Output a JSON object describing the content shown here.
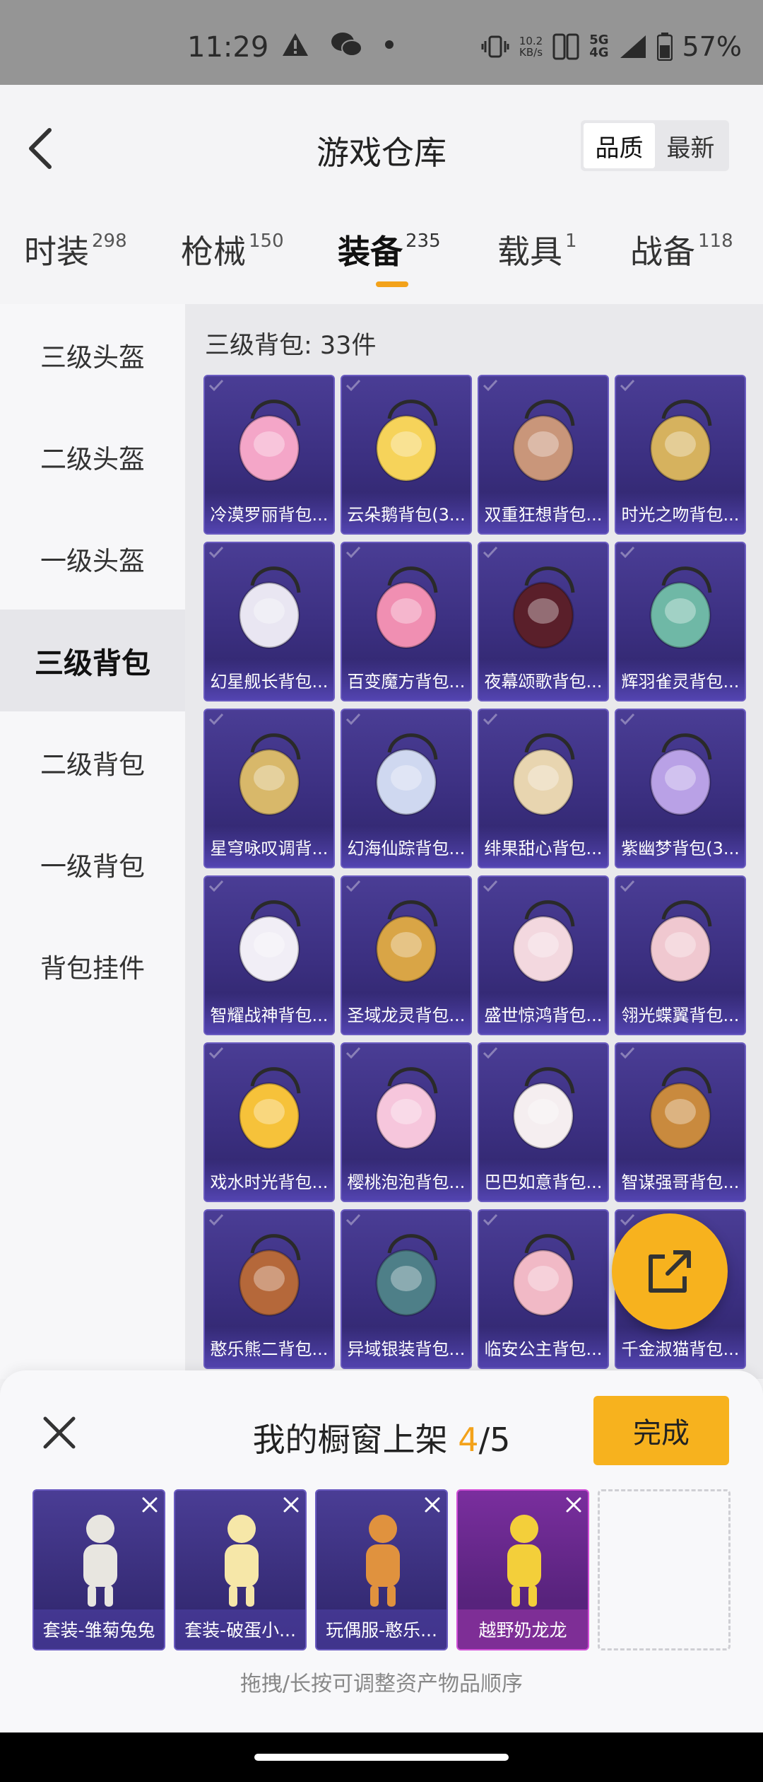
{
  "status_bar": {
    "time": "11:29",
    "net_speed_value": "10.2",
    "net_speed_unit": "KB/s",
    "signal_label_top": "5G",
    "signal_label_bottom": "4G",
    "battery": "57%"
  },
  "header": {
    "title": "游戏仓库",
    "sort_options": [
      "品质",
      "最新"
    ],
    "sort_selected": "品质"
  },
  "tabs": [
    {
      "label": "时装",
      "count": "298"
    },
    {
      "label": "枪械",
      "count": "150"
    },
    {
      "label": "装备",
      "count": "235",
      "active": true
    },
    {
      "label": "载具",
      "count": "1"
    },
    {
      "label": "战备",
      "count": "118"
    }
  ],
  "sidebar": {
    "items": [
      "三级头盔",
      "二级头盔",
      "一级头盔",
      "三级背包",
      "二级背包",
      "一级背包",
      "背包挂件"
    ],
    "active": "三级背包"
  },
  "content": {
    "section_label": "三级背包: 33件",
    "items": [
      {
        "name": "冷漠罗丽背包...",
        "icon": "heart-backpack-icon",
        "color": "#f4a6c8"
      },
      {
        "name": "云朵鹅背包(3...",
        "icon": "duck-backpack-icon",
        "color": "#f6d35a"
      },
      {
        "name": "双重狂想背包...",
        "icon": "fawn-backpack-icon",
        "color": "#c9967a"
      },
      {
        "name": "时光之吻背包...",
        "icon": "clock-backpack-icon",
        "color": "#d6b25e"
      },
      {
        "name": "幻星舰长背包...",
        "icon": "rocket-backpack-icon",
        "color": "#e9e6f2"
      },
      {
        "name": "百变魔方背包...",
        "icon": "cube-backpack-icon",
        "color": "#f08fb2"
      },
      {
        "name": "夜幕颂歌背包...",
        "icon": "dark-rose-backpack-icon",
        "color": "#5a1f2a"
      },
      {
        "name": "辉羽雀灵背包...",
        "icon": "bird-backpack-icon",
        "color": "#6fb8a6"
      },
      {
        "name": "星穹咏叹调背...",
        "icon": "harp-backpack-icon",
        "color": "#d8b86a"
      },
      {
        "name": "幻海仙踪背包...",
        "icon": "crystal-backpack-icon",
        "color": "#cfd8f0"
      },
      {
        "name": "绯果甜心背包...",
        "icon": "clown-backpack-icon",
        "color": "#e8d5b0"
      },
      {
        "name": "紫幽梦背包(3...",
        "icon": "lotus-backpack-icon",
        "color": "#b9a1e6"
      },
      {
        "name": "智耀战神背包...",
        "icon": "armor-backpack-icon",
        "color": "#f1eef6"
      },
      {
        "name": "圣域龙灵背包...",
        "icon": "dragon-backpack-icon",
        "color": "#d9a546"
      },
      {
        "name": "盛世惊鸿背包...",
        "icon": "feather-backpack-icon",
        "color": "#f3d8df"
      },
      {
        "name": "翎光蝶翼背包...",
        "icon": "butterfly-heart-backpack-icon",
        "color": "#f0c8d0"
      },
      {
        "name": "戏水时光背包...",
        "icon": "chick-backpack-icon",
        "color": "#f6c23a"
      },
      {
        "name": "樱桃泡泡背包...",
        "icon": "bow-backpack-icon",
        "color": "#f6c6dc"
      },
      {
        "name": "巴巴如意背包...",
        "icon": "cat-backpack-icon",
        "color": "#f5eef0"
      },
      {
        "name": "智谋强哥背包...",
        "icon": "monkey-backpack-icon",
        "color": "#c98a3e"
      },
      {
        "name": "憨乐熊二背包...",
        "icon": "bear-backpack-icon",
        "color": "#b5683a"
      },
      {
        "name": "异域银装背包...",
        "icon": "tactical-backpack-icon",
        "color": "#4e7f88"
      },
      {
        "name": "临安公主背包...",
        "icon": "lantern-backpack-icon",
        "color": "#f1b9c6"
      },
      {
        "name": "千金淑猫背包...",
        "icon": "lady-cat-backpack-icon",
        "color": "#e8c9a6"
      }
    ]
  },
  "fab": {
    "icon": "share-export-icon"
  },
  "showcase": {
    "title_prefix": "我的橱窗上架 ",
    "count_current": "4",
    "count_sep": "/",
    "count_total": "5",
    "done_label": "完成",
    "slots": [
      {
        "name": "套装-雏菊兔兔",
        "icon": "bunny-couple-icon",
        "color": "#e8e6e0",
        "style": "purple"
      },
      {
        "name": "套装-破蛋小...",
        "icon": "egg-chick-icon",
        "color": "#f6e7a8",
        "style": "purple"
      },
      {
        "name": "玩偶服-憨乐...",
        "icon": "bear-costume-icon",
        "color": "#e0923e",
        "style": "purple"
      },
      {
        "name": "越野奶龙龙",
        "icon": "yellow-car-icon",
        "color": "#f3cf3a",
        "style": "pink"
      }
    ],
    "hint": "拖拽/长按可调整资产物品顺序"
  }
}
